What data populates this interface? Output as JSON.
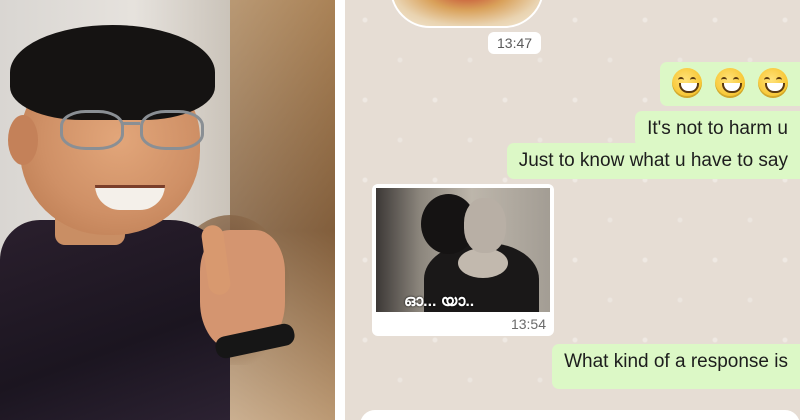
{
  "left_photo": {
    "alt": "Man smiling and raising index finger"
  },
  "chat": {
    "time_1": "13:47",
    "emoji_count": 3,
    "msg_1": "It's not to harm u",
    "msg_2": "Just to know what u have to say",
    "image_caption": "ഓ... യാ..",
    "time_2": "13:54",
    "msg_3": "What kind of a response is",
    "colors": {
      "outgoing_bubble": "#dcf8c6",
      "background": "#e6ddd4"
    }
  }
}
